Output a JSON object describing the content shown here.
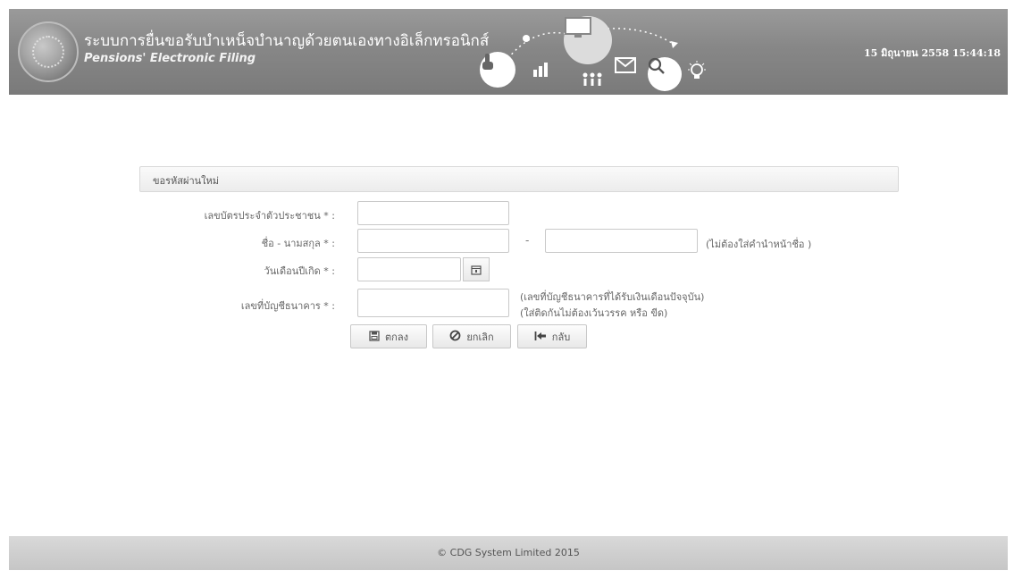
{
  "header": {
    "title_th": "ระบบการยื่นขอรับบำเหน็จบำนาญด้วยตนเองทางอิเล็กทรอนิกส์",
    "title_en": "Pensions' Electronic Filing",
    "datetime": "15 มิถุนายน 2558 15:44:18",
    "icons": [
      "seal-logo",
      "touch-icon",
      "chart-icon",
      "monitor-icon",
      "people-icon",
      "mail-icon",
      "search-icon",
      "lightbulb-icon"
    ]
  },
  "form": {
    "panel_title": "ขอรหัสผ่านใหม่",
    "fields": {
      "id_card": {
        "label": "เลขบัตรประจำตัวประชาชน",
        "required": "* :",
        "value": ""
      },
      "name": {
        "label": "ชื่อ - นามสกุล",
        "required": "* :",
        "first_value": "",
        "dash": "-",
        "last_value": "",
        "hint": "(ไม่ต้องใส่คำนำหน้าชื่อ )"
      },
      "birthdate": {
        "label": "วันเดือนปีเกิด",
        "required": "* :",
        "value": ""
      },
      "bank_account": {
        "label": "เลขที่บัญชีธนาคาร",
        "required": "* :",
        "value": "",
        "hint1": "(เลขที่บัญชีธนาคารที่ได้รับเงินเดือนปัจจุบัน)",
        "hint2": "(ใส่ติดกันไม่ต้องเว้นวรรค หรือ ขีด)"
      }
    },
    "buttons": {
      "ok": "ตกลง",
      "cancel": "ยกเลิก",
      "back": "กลับ"
    }
  },
  "footer": {
    "copyright": "© CDG System Limited 2015"
  }
}
